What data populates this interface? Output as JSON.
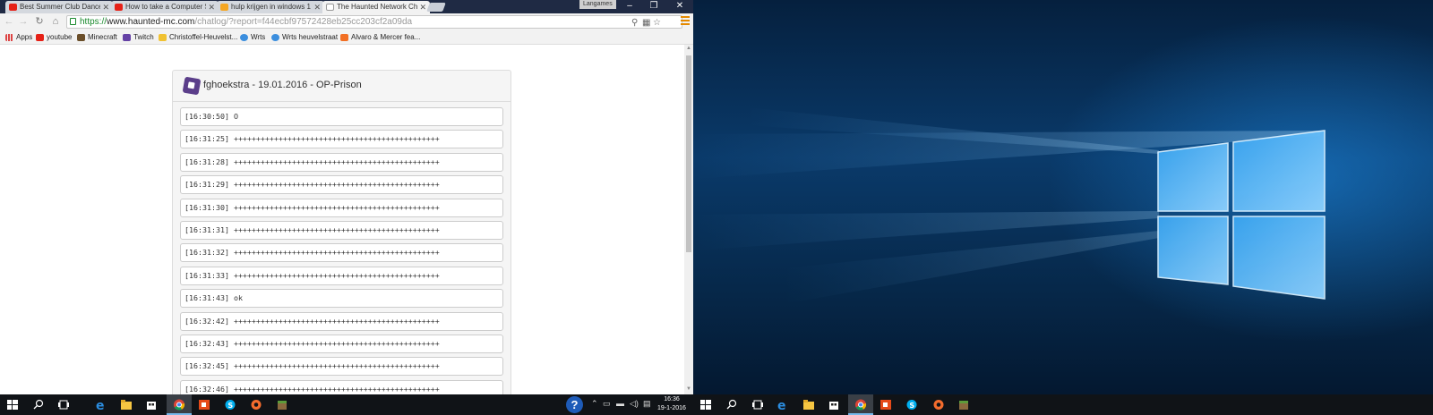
{
  "browser": {
    "tabs": [
      {
        "label": "Best Summer Club Dance",
        "favicon_color": "#e62117"
      },
      {
        "label": "How to take a Computer S",
        "favicon_color": "#e62117"
      },
      {
        "label": "hulp krijgen in windows 1",
        "favicon_color": "#f5a623"
      },
      {
        "label": "The Haunted Network Ch",
        "favicon_color": "#eeeeee"
      }
    ],
    "profile_name": "Langames",
    "url_scheme": "https://",
    "url_host": "www.haunted-mc.com",
    "url_path": "/chatlog/?report=f44ecbf97572428eb25cc203cf2a09da",
    "bookmarks": [
      {
        "label": "Apps",
        "icon": "apps-grid-icon",
        "color": "#d44"
      },
      {
        "label": "youtube",
        "icon": "youtube-icon",
        "color": "#e62117"
      },
      {
        "label": "Minecraft",
        "icon": "minecraft-icon",
        "color": "#6b4f2a"
      },
      {
        "label": "Twitch",
        "icon": "twitch-icon",
        "color": "#6441a5"
      },
      {
        "label": "Christoffel-Heuvelst...",
        "icon": "folder-icon",
        "color": "#f1c232"
      },
      {
        "label": "Wrts",
        "icon": "wrts-icon",
        "color": "#3b8ede"
      },
      {
        "label": "Wrts heuvelstraat",
        "icon": "wrts-icon",
        "color": "#3b8ede"
      },
      {
        "label": "Alvaro & Mercer fea...",
        "icon": "soundcloud-icon",
        "color": "#f26f23"
      }
    ]
  },
  "chatlog": {
    "title": "fghoekstra - 19.01.2016 - OP-Prison",
    "rows": [
      "[16:30:50] O",
      "[16:31:25] ++++++++++++++++++++++++++++++++++++++++++++++",
      "[16:31:28] ++++++++++++++++++++++++++++++++++++++++++++++",
      "[16:31:29] ++++++++++++++++++++++++++++++++++++++++++++++",
      "[16:31:30] ++++++++++++++++++++++++++++++++++++++++++++++",
      "[16:31:31] ++++++++++++++++++++++++++++++++++++++++++++++",
      "[16:31:32] ++++++++++++++++++++++++++++++++++++++++++++++",
      "[16:31:33] ++++++++++++++++++++++++++++++++++++++++++++++",
      "[16:31:43] ok",
      "[16:32:42] ++++++++++++++++++++++++++++++++++++++++++++++",
      "[16:32:43] ++++++++++++++++++++++++++++++++++++++++++++++",
      "[16:32:45] ++++++++++++++++++++++++++++++++++++++++++++++",
      "[16:32:46] ++++++++++++++++++++++++++++++++++++++++++++++"
    ]
  },
  "taskbar": {
    "clock_time": "16:36",
    "clock_date": "19-1-2016",
    "help_symbol": "?",
    "left_apps": [
      "start-icon",
      "search-icon",
      "task-view-icon",
      "edge-icon",
      "file-explorer-icon",
      "store-icon",
      "chrome-icon",
      "office-icon",
      "skype-icon",
      "origin-icon",
      "minecraft-icon"
    ],
    "right_apps": [
      "start-icon",
      "search-icon",
      "task-view-icon",
      "edge-icon",
      "file-explorer-icon",
      "store-icon",
      "chrome-icon",
      "office-icon",
      "skype-icon",
      "origin-icon",
      "minecraft-icon"
    ]
  }
}
